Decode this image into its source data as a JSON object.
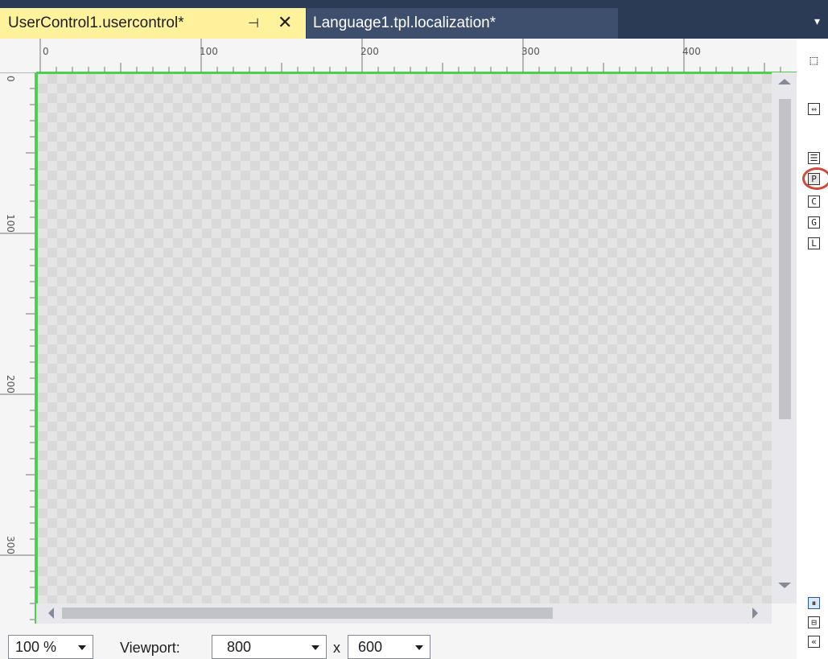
{
  "tabs": {
    "active": {
      "title": "UserControl1.usercontrol*",
      "pin_icon": "pin-icon",
      "close_icon": "close-icon",
      "pin_glyph": "⊣",
      "close_glyph": "✕"
    },
    "inactive": {
      "title": "Language1.tpl.localization*"
    },
    "overflow_icon": "dropdown-icon",
    "overflow_glyph": "▾"
  },
  "rulers": {
    "horizontal_labels": [
      "0",
      "100",
      "200",
      "300",
      "400"
    ],
    "vertical_labels": [
      "0",
      "100",
      "200",
      "300"
    ]
  },
  "right_toolbar": {
    "buttons": [
      {
        "name": "pointer-tool-icon",
        "glyph": "⬚"
      },
      {
        "name": "code-view-icon",
        "glyph": "⇔"
      },
      {
        "name": "properties-list-icon",
        "glyph": "☰"
      },
      {
        "name": "p-button",
        "glyph": "P"
      },
      {
        "name": "c-button",
        "glyph": "C"
      },
      {
        "name": "g-button",
        "glyph": "G"
      },
      {
        "name": "l-button",
        "glyph": "L"
      }
    ],
    "layout_buttons": [
      {
        "name": "vertical-split-icon",
        "glyph": "⏸"
      },
      {
        "name": "horizontal-split-icon",
        "glyph": "⊟"
      },
      {
        "name": "collapse-icon",
        "glyph": "«"
      }
    ]
  },
  "bottom": {
    "zoom": "100 %",
    "viewport_label": "Viewport:",
    "width": "800",
    "x_label": "x",
    "height": "600"
  },
  "colors": {
    "active_tab": "#fff29d",
    "tab_bar": "#2b3a55",
    "canvas_border": "#4fcf4f",
    "highlight_ring": "#d04a3a"
  }
}
